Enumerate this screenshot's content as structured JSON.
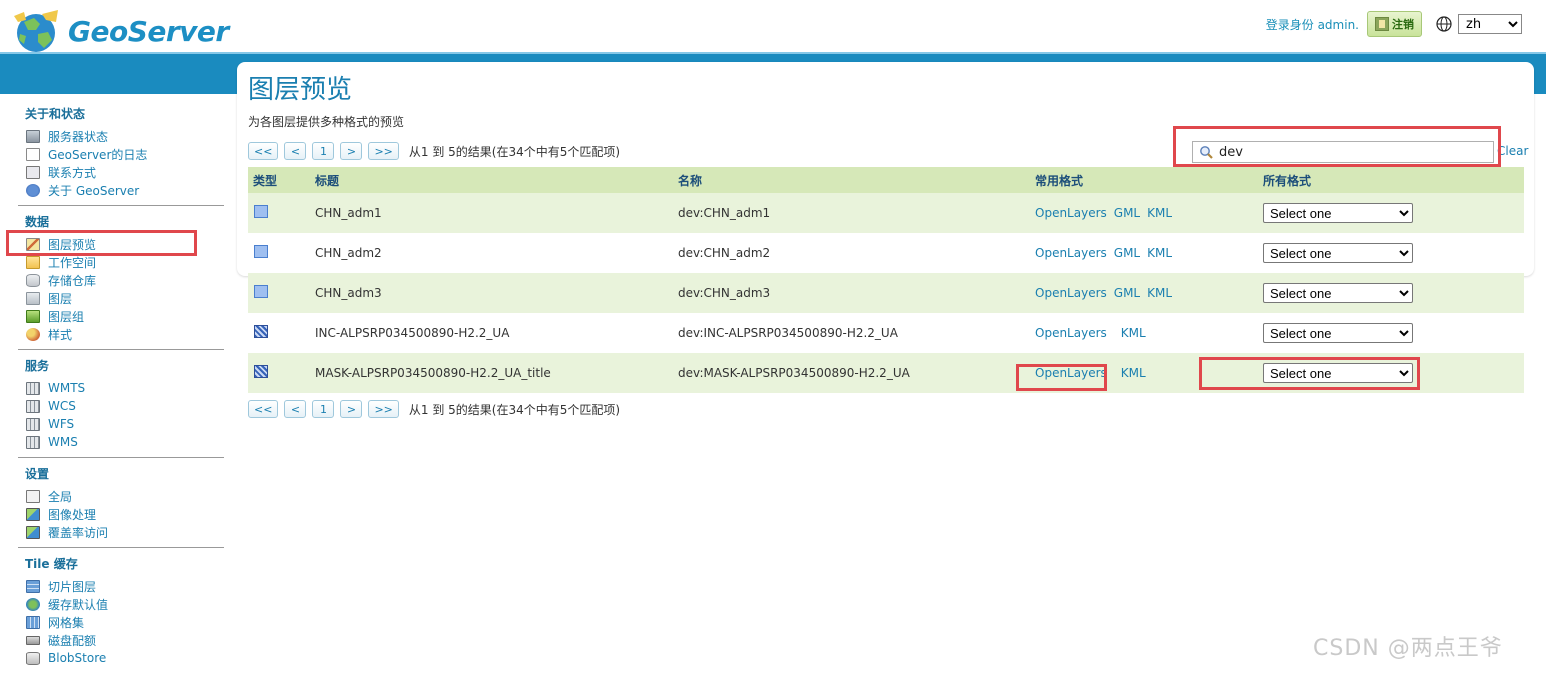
{
  "header": {
    "logo_text": "GeoServer",
    "login_text": "登录身份 admin.",
    "logout_label": "注销",
    "language": "zh"
  },
  "sidebar": {
    "sections": [
      {
        "title": "关于和状态",
        "items": [
          {
            "label": "服务器状态",
            "icon": "server-icon"
          },
          {
            "label": "GeoServer的日志",
            "icon": "document-icon"
          },
          {
            "label": "联系方式",
            "icon": "contact-card-icon"
          },
          {
            "label": "关于 GeoServer",
            "icon": "info-icon"
          }
        ]
      },
      {
        "title": "数据",
        "items": [
          {
            "label": "图层预览",
            "icon": "layer-preview-icon"
          },
          {
            "label": "工作空间",
            "icon": "folder-icon"
          },
          {
            "label": "存储仓库",
            "icon": "database-icon"
          },
          {
            "label": "图层",
            "icon": "layer-icon"
          },
          {
            "label": "图层组",
            "icon": "layer-group-icon"
          },
          {
            "label": "样式",
            "icon": "palette-icon"
          }
        ]
      },
      {
        "title": "服务",
        "items": [
          {
            "label": "WMTS",
            "icon": "service-icon"
          },
          {
            "label": "WCS",
            "icon": "service-icon"
          },
          {
            "label": "WFS",
            "icon": "service-icon"
          },
          {
            "label": "WMS",
            "icon": "service-icon"
          }
        ]
      },
      {
        "title": "设置",
        "items": [
          {
            "label": "全局",
            "icon": "global-settings-icon"
          },
          {
            "label": "图像处理",
            "icon": "image-processing-icon"
          },
          {
            "label": "覆盖率访问",
            "icon": "coverage-access-icon"
          }
        ]
      },
      {
        "title": "Tile 缓存",
        "items": [
          {
            "label": "切片图层",
            "icon": "tile-layer-icon"
          },
          {
            "label": "缓存默认值",
            "icon": "globe-icon"
          },
          {
            "label": "网格集",
            "icon": "gridset-icon"
          },
          {
            "label": "磁盘配额",
            "icon": "disk-icon"
          },
          {
            "label": "BlobStore",
            "icon": "blobstore-icon"
          }
        ]
      }
    ]
  },
  "main": {
    "title": "图层预览",
    "description": "为各图层提供多种格式的预览",
    "pager": {
      "first": "<<",
      "prev": "<",
      "page": "1",
      "next": ">",
      "last": ">>",
      "info": "从1 到 5的结果(在34个中有5个匹配项)"
    },
    "search": {
      "value": "dev",
      "clear": "Clear"
    },
    "table": {
      "headers": [
        "类型",
        "标题",
        "名称",
        "常用格式",
        "所有格式"
      ],
      "rows": [
        {
          "type": "polygon",
          "title": "CHN_adm1",
          "name": "dev:CHN_adm1",
          "formats": [
            "OpenLayers",
            "GML",
            "KML"
          ],
          "select": "Select one"
        },
        {
          "type": "polygon",
          "title": "CHN_adm2",
          "name": "dev:CHN_adm2",
          "formats": [
            "OpenLayers",
            "GML",
            "KML"
          ],
          "select": "Select one"
        },
        {
          "type": "polygon",
          "title": "CHN_adm3",
          "name": "dev:CHN_adm3",
          "formats": [
            "OpenLayers",
            "GML",
            "KML"
          ],
          "select": "Select one"
        },
        {
          "type": "raster",
          "title": "INC-ALPSRP034500890-H2.2_UA",
          "name": "dev:INC-ALPSRP034500890-H2.2_UA",
          "formats": [
            "OpenLayers",
            "",
            "KML"
          ],
          "select": "Select one"
        },
        {
          "type": "raster",
          "title": "MASK-ALPSRP034500890-H2.2_UA_title",
          "name": "dev:MASK-ALPSRP034500890-H2.2_UA",
          "formats": [
            "OpenLayers",
            "",
            "KML"
          ],
          "select": "Select one"
        }
      ]
    }
  },
  "watermark": "CSDN @两点王爷",
  "colors": {
    "accent": "#1a8bbf",
    "header_row": "#d6e8b8",
    "odd_row": "#e9f3db",
    "highlight": "#e0474c"
  }
}
